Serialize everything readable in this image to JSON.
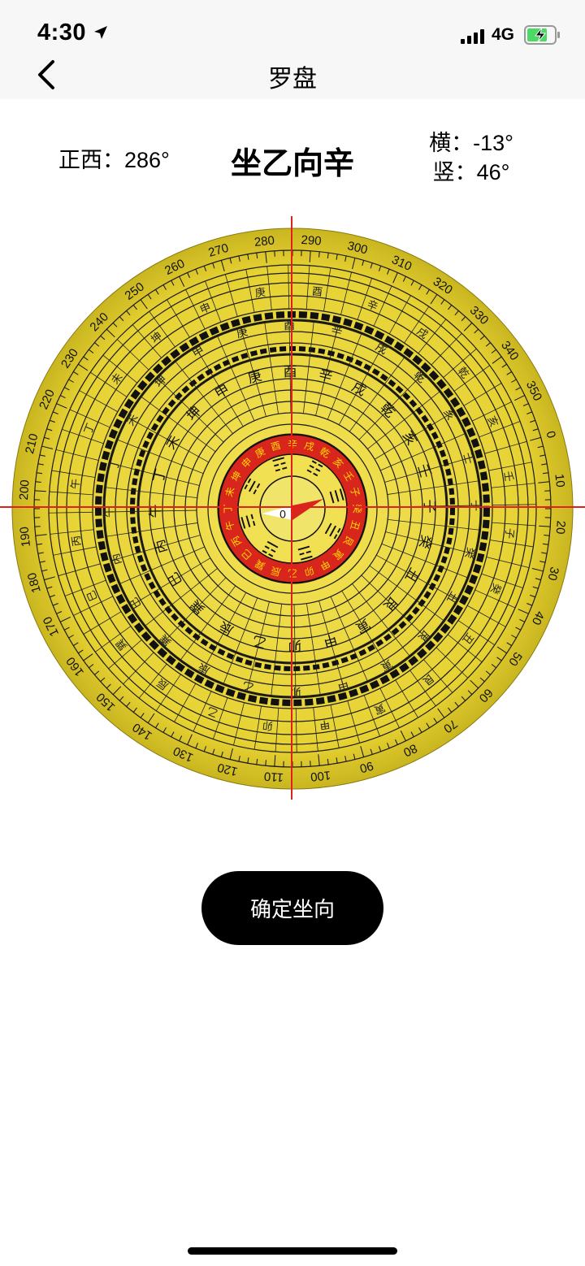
{
  "status": {
    "time": "4:30",
    "network": "4G"
  },
  "nav": {
    "title": "罗盘"
  },
  "reading": {
    "direction_text": "正西：286°",
    "sitting_facing": "坐乙向辛",
    "horizontal": "横：-13°",
    "vertical": "竖：46°"
  },
  "compass": {
    "heading_deg": 286,
    "degree_labels": [
      "0",
      "10",
      "20",
      "30",
      "40",
      "50",
      "60",
      "70",
      "80",
      "90",
      "100",
      "110",
      "120",
      "130",
      "140",
      "150",
      "160",
      "170",
      "180",
      "190",
      "200",
      "210",
      "220",
      "230",
      "240",
      "250",
      "260",
      "270",
      "280",
      "290",
      "300",
      "310",
      "320",
      "330",
      "340",
      "350"
    ],
    "mountains_24": [
      "壬",
      "子",
      "癸",
      "丑",
      "艮",
      "寅",
      "甲",
      "卯",
      "乙",
      "辰",
      "巽",
      "巳",
      "丙",
      "午",
      "丁",
      "未",
      "坤",
      "申",
      "庚",
      "酉",
      "辛",
      "戌",
      "乾",
      "亥"
    ],
    "red_ring": [
      "辛",
      "戌",
      "乾",
      "亥",
      "壬",
      "子",
      "癸",
      "丑",
      "艮",
      "寅",
      "甲",
      "卯",
      "乙",
      "辰",
      "巽",
      "巳",
      "丙",
      "午",
      "丁",
      "未",
      "坤",
      "申",
      "庚",
      "酉"
    ],
    "trigrams": [
      "☰",
      "☱",
      "☲",
      "☳",
      "☴",
      "☵",
      "☶",
      "☷"
    ],
    "center_label": "0"
  },
  "actions": {
    "confirm_label": "确定坐向"
  },
  "colors": {
    "compass_fill": "#e9d83a",
    "ring_red": "#d8261c",
    "crosshair": "#e0201a"
  }
}
